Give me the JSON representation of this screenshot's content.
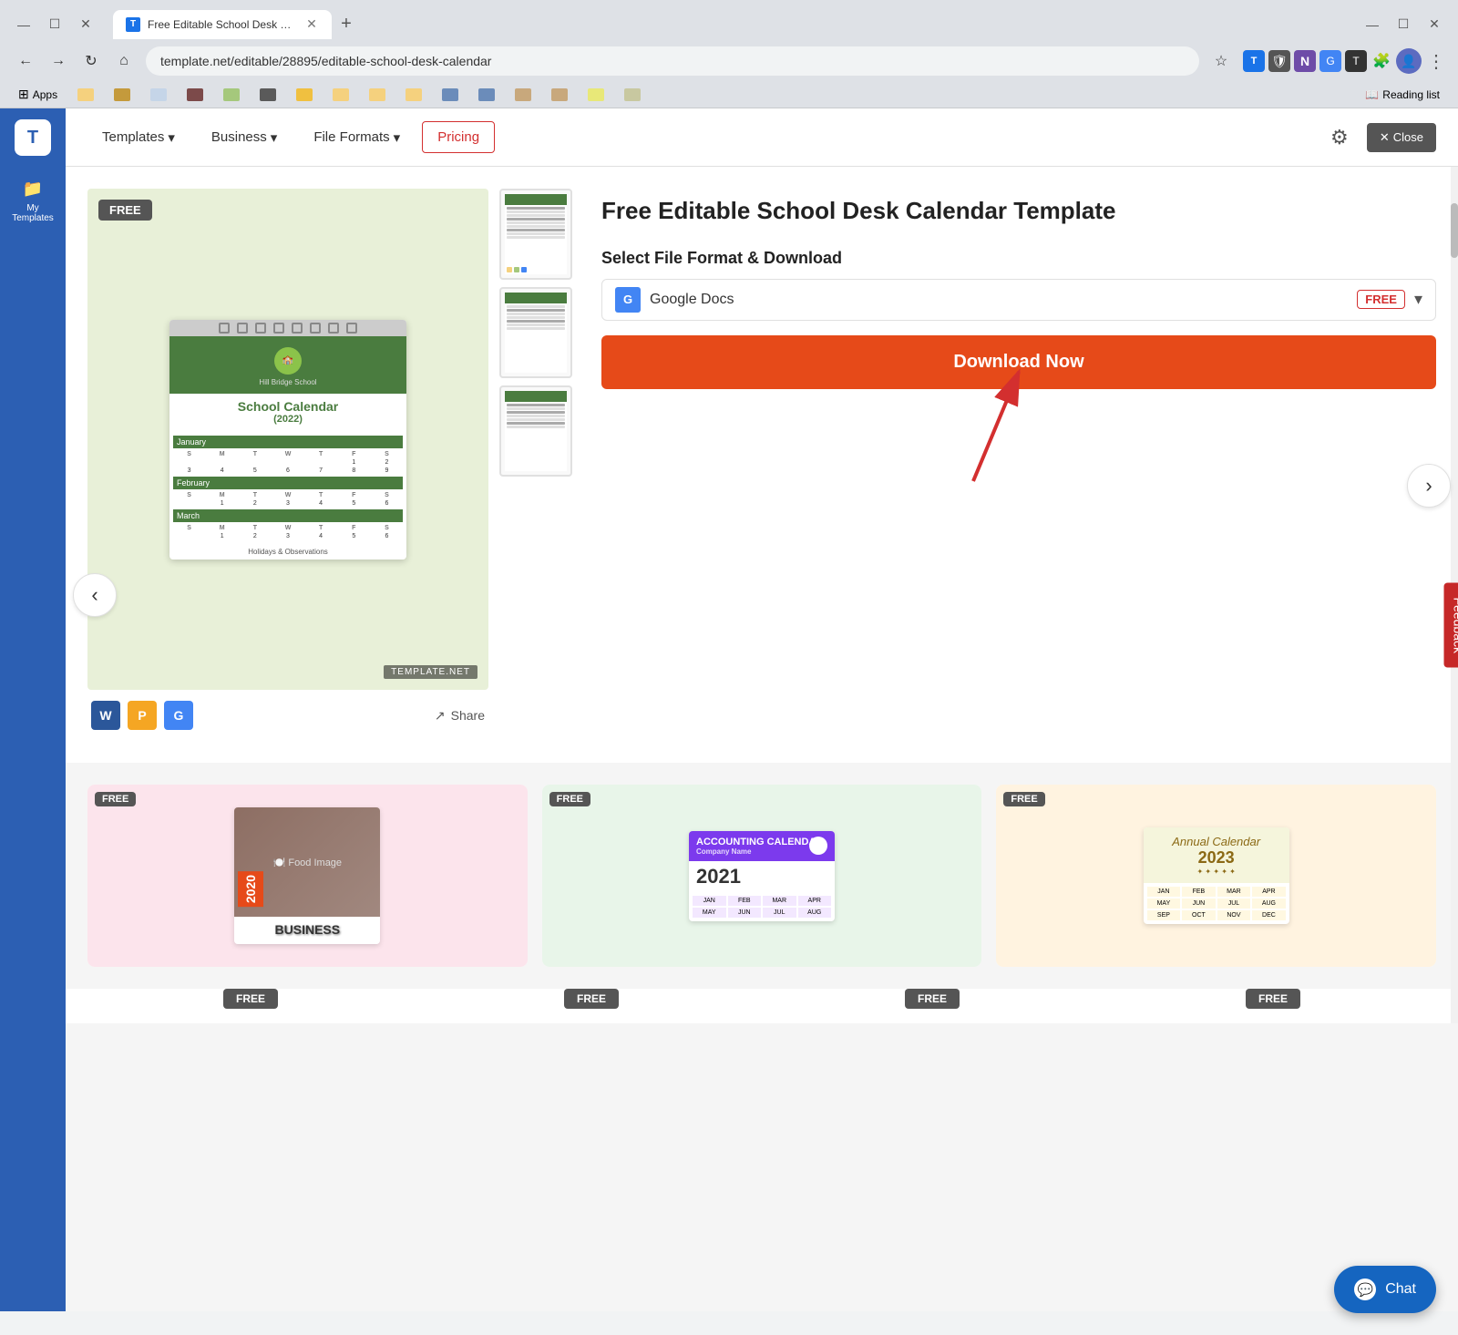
{
  "browser": {
    "tab_title": "Free Editable School Desk Calen...",
    "tab_favicon": "T",
    "url": "template.net/editable/28895/editable-school-desk-calendar",
    "new_tab_label": "+",
    "back_disabled": false,
    "forward_disabled": false,
    "reading_list_label": "Reading list",
    "apps_label": "Apps",
    "bookmarks": [
      {
        "color": "#f5d17e"
      },
      {
        "color": "#c49a3c"
      },
      {
        "color": "#c5d5e8"
      },
      {
        "color": "#7c4a4a"
      },
      {
        "color": "#a5c87c"
      },
      {
        "color": "#5a5a5a"
      },
      {
        "color": "#f0c040"
      },
      {
        "color": "#f5d17e"
      },
      {
        "color": "#f5d17e"
      },
      {
        "color": "#f5d17e"
      },
      {
        "color": "#6b8cba"
      },
      {
        "color": "#6b8cba"
      },
      {
        "color": "#c8a87c"
      },
      {
        "color": "#c8a87c"
      },
      {
        "color": "#e8e878"
      },
      {
        "color": "#c8c8a0"
      },
      {
        "color": "#f5d17e"
      }
    ]
  },
  "sidebar": {
    "logo": "T",
    "items": [
      {
        "label": "My Templates",
        "icon": "📁"
      },
      {
        "label": "",
        "icon": ""
      }
    ]
  },
  "nav": {
    "items": [
      {
        "label": "Templates",
        "has_arrow": true
      },
      {
        "label": "Business",
        "has_arrow": true
      },
      {
        "label": "File Formats",
        "has_arrow": true
      },
      {
        "label": "Pricing",
        "active": true
      }
    ],
    "settings_icon": "⚙",
    "close_label": "Close"
  },
  "template": {
    "free_badge": "FREE",
    "title": "Free Editable School Desk Calendar Template",
    "section_label": "Select File Format & Download",
    "format": {
      "icon": "G",
      "name": "Google Docs",
      "tag": "FREE"
    },
    "download_label": "Download Now",
    "share_label": "Share",
    "format_icons": [
      {
        "type": "word",
        "label": "W"
      },
      {
        "type": "pages",
        "label": "P"
      },
      {
        "type": "docs",
        "label": "G"
      }
    ],
    "watermark": "TEMPLATE.NET",
    "calendar": {
      "school_name": "Hill Bridge School",
      "title": "School Calendar",
      "year": "(2022)",
      "subtitle": "Holidays & Observations"
    }
  },
  "thumbnails": [
    {
      "id": 1
    },
    {
      "id": 2
    },
    {
      "id": 3
    }
  ],
  "bottom_cards": [
    {
      "free_badge": "FREE",
      "type": "food",
      "year_label": "2020",
      "title_text": "BUSINESS"
    },
    {
      "free_badge": "FREE",
      "type": "accounting",
      "header": "ACCOUNTING CALENDAR",
      "year": "2021"
    },
    {
      "free_badge": "FREE",
      "type": "annual",
      "title": "Annual Calendar",
      "year": "2023"
    }
  ],
  "bottom_row_badges": [
    "FREE",
    "FREE",
    "FREE",
    "FREE"
  ],
  "feedback_label": "Feedback",
  "chat_label": "Chat",
  "nav_arrows": {
    "left": "‹",
    "right": "›"
  }
}
